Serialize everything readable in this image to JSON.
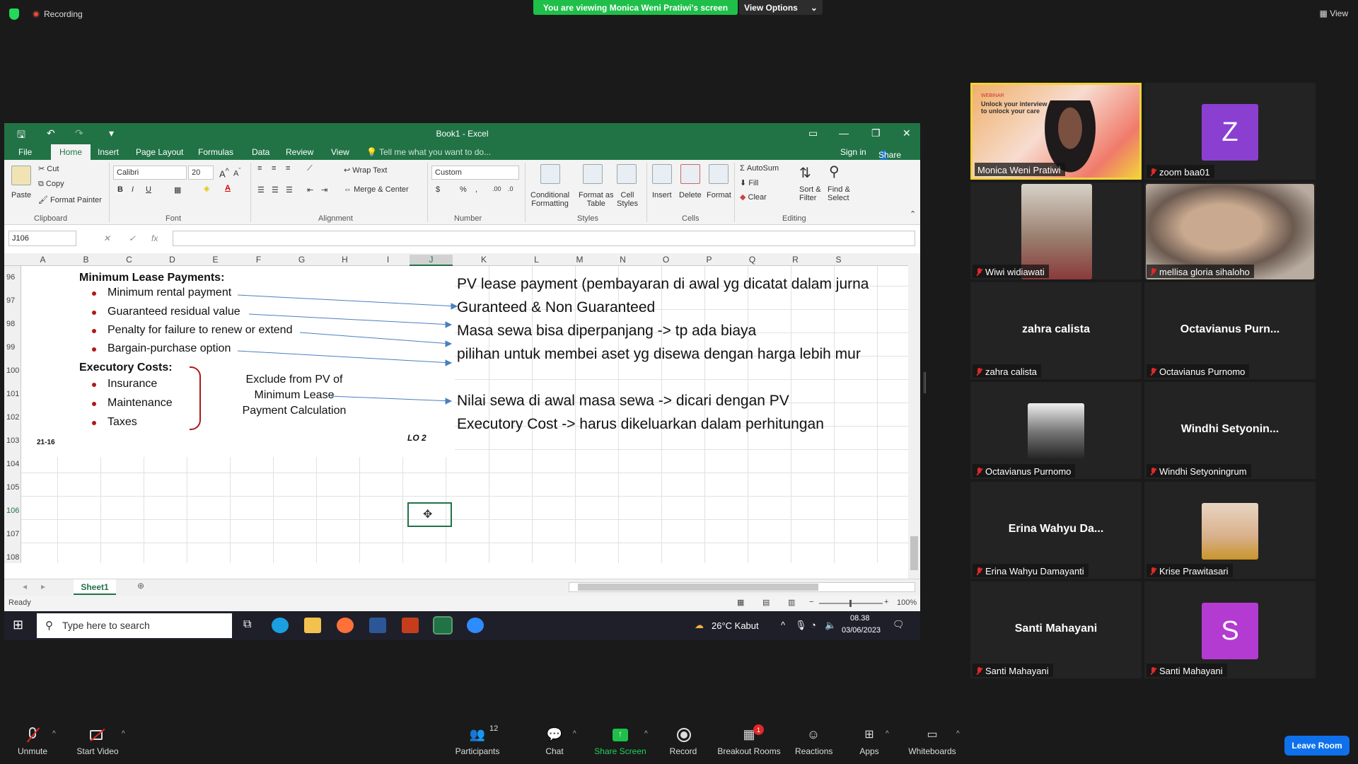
{
  "top": {
    "recording": "Recording",
    "viewing_banner": "You are viewing Monica Weni Pratiwi's screen",
    "view_options": "View Options",
    "view": "View"
  },
  "excel": {
    "title": "Book1 - Excel",
    "tabs": [
      "File",
      "Home",
      "Insert",
      "Page Layout",
      "Formulas",
      "Data",
      "Review",
      "View"
    ],
    "tell_me": "Tell me what you want to do...",
    "sign_in": "Sign in",
    "share": "Share",
    "clipboard": {
      "paste": "Paste",
      "cut": "Cut",
      "copy": "Copy",
      "format_painter": "Format Painter",
      "group": "Clipboard"
    },
    "font": {
      "name": "Calibri",
      "size": "20",
      "group": "Font"
    },
    "alignment": {
      "wrap": "Wrap Text",
      "merge": "Merge & Center",
      "group": "Alignment"
    },
    "number": {
      "format": "Custom",
      "group": "Number"
    },
    "styles": {
      "cond": "Conditional",
      "cond2": "Formatting",
      "table": "Format as",
      "table2": "Table",
      "cell": "Cell",
      "cell2": "Styles",
      "group": "Styles"
    },
    "cells": {
      "insert": "Insert",
      "delete": "Delete",
      "format": "Format",
      "group": "Cells"
    },
    "editing": {
      "autosum": "AutoSum",
      "fill": "Fill",
      "clear": "Clear",
      "sort": "Sort &",
      "sort2": "Filter",
      "find": "Find &",
      "find2": "Select",
      "group": "Editing"
    },
    "name_box": "J106",
    "columns": [
      "A",
      "B",
      "C",
      "D",
      "E",
      "F",
      "G",
      "H",
      "I",
      "J",
      "K",
      "L",
      "M",
      "N",
      "O",
      "P",
      "Q",
      "R",
      "S"
    ],
    "rows": [
      "96",
      "97",
      "98",
      "99",
      "100",
      "101",
      "102",
      "103",
      "104",
      "105",
      "106",
      "107",
      "108"
    ],
    "slide": {
      "heading1": "Minimum Lease Payments:",
      "items1": [
        "Minimum rental payment",
        "Guaranteed residual value",
        "Penalty for failure to renew or extend",
        "Bargain-purchase option"
      ],
      "heading2": "Executory Costs:",
      "items2": [
        "Insurance",
        "Maintenance",
        "Taxes"
      ],
      "note": [
        "Exclude from PV of",
        "Minimum Lease",
        "Payment Calculation"
      ],
      "footer_left": "21-16",
      "footer_right": "LO 2"
    },
    "notes": [
      "PV lease payment (pembayaran di awal yg dicatat dalam jurna",
      "Guranteed & Non Guaranteed",
      "Masa sewa bisa diperpanjang -> tp ada biaya",
      "pilihan untuk membei aset yg disewa dengan harga lebih mur",
      "Nilai sewa di awal masa sewa -> dicari dengan PV",
      "Executory Cost -> harus dikeluarkan dalam perhitungan"
    ],
    "sheet_tab": "Sheet1",
    "status": "Ready",
    "zoom": "100%",
    "taskbar": {
      "search": "Type here to search",
      "weather": "26°C  Kabut",
      "time": "08.38",
      "date": "03/06/2023"
    }
  },
  "participants": [
    {
      "label": "Monica Weni Pratiwi",
      "name": ""
    },
    {
      "label": "zoom baa01",
      "name": "",
      "initial": "Z"
    },
    {
      "label": "Wiwi widiawati",
      "name": ""
    },
    {
      "label": "mellisa gloria sihaloho",
      "name": ""
    },
    {
      "label": "zahra calista",
      "name": "zahra calista"
    },
    {
      "label": "Octavianus Purnomo",
      "name": "Octavianus  Purn..."
    },
    {
      "label": "Octavianus Purnomo",
      "name": ""
    },
    {
      "label": "Windhi Setyoningrum",
      "name": "Windhi  Setyonin..."
    },
    {
      "label": "Erina Wahyu Damayanti",
      "name": "Erina  Wahyu  Da..."
    },
    {
      "label": "Krise Prawitasari",
      "name": ""
    },
    {
      "label": "Santi Mahayani",
      "name": "Santi Mahayani"
    },
    {
      "label": "Santi Mahayani",
      "name": "",
      "initial": "S"
    }
  ],
  "webinar_text": {
    "tag": "WEBINAR",
    "line1": "Unlock your interview",
    "line2": "to unlock your care"
  },
  "toolbar": {
    "unmute": "Unmute",
    "start_video": "Start Video",
    "participants": "Participants",
    "participant_count": "12",
    "chat": "Chat",
    "share_screen": "Share Screen",
    "record": "Record",
    "breakout": "Breakout Rooms",
    "breakout_badge": "1",
    "reactions": "Reactions",
    "apps": "Apps",
    "whiteboards": "Whiteboards",
    "leave": "Leave Room"
  },
  "colors": {
    "excel_green": "#217346",
    "zoom_green": "#1fbf4a",
    "leave_blue": "#0e71eb",
    "avatar_z": "#8a3fd1",
    "avatar_s": "#b33bd1"
  }
}
